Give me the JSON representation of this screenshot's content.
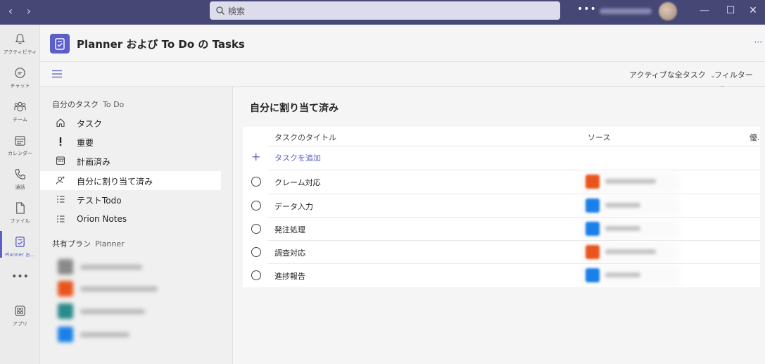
{
  "window": {
    "search_placeholder": "検索",
    "more_label": "•••"
  },
  "rail": {
    "items": [
      {
        "label": "アクティビティ",
        "icon": "bell-icon"
      },
      {
        "label": "チャット",
        "icon": "chat-icon"
      },
      {
        "label": "チーム",
        "icon": "teams-icon"
      },
      {
        "label": "カレンダー",
        "icon": "calendar-icon"
      },
      {
        "label": "通話",
        "icon": "phone-icon"
      },
      {
        "label": "ファイル",
        "icon": "file-icon"
      },
      {
        "label": "Planner お...",
        "icon": "planner-icon",
        "active": true
      },
      {
        "label": "アプリ",
        "icon": "apps-icon"
      }
    ],
    "more_label": "•••"
  },
  "header": {
    "title": "Planner および To Do の Tasks",
    "more_label": "···"
  },
  "toolbar": {
    "filter_scope": "アクティブな全タスク",
    "filter_label": "フィルター"
  },
  "leftnav": {
    "my_tasks_section": "自分のタスク",
    "my_tasks_sub": "To Do",
    "items": [
      {
        "label": "タスク",
        "icon": "home-icon"
      },
      {
        "label": "重要",
        "icon": "exclamation-icon"
      },
      {
        "label": "計画済み",
        "icon": "calendar-icon"
      },
      {
        "label": "自分に割り当て済み",
        "icon": "person-assigned-icon",
        "selected": true
      },
      {
        "label": "テストTodo",
        "icon": "list-icon"
      },
      {
        "label": "Orion Notes",
        "icon": "list-icon"
      }
    ],
    "shared_section": "共有プラン",
    "shared_sub": "Planner",
    "plans": [
      {
        "color": "#8a8a8a"
      },
      {
        "color": "#e8541c"
      },
      {
        "color": "#2a8a8a"
      },
      {
        "color": "#1a7fe8"
      }
    ]
  },
  "main": {
    "title": "自分に割り当て済み",
    "columns": {
      "title": "タスクのタイトル",
      "source": "ソース",
      "priority": "優."
    },
    "add_task_label": "タスクを追加",
    "tasks": [
      {
        "title": "クレーム対応",
        "source_color": "#e8541c"
      },
      {
        "title": "データ入力",
        "source_color": "#1a7fe8"
      },
      {
        "title": "発注処理",
        "source_color": "#1a7fe8"
      },
      {
        "title": "調査対応",
        "source_color": "#e8541c"
      },
      {
        "title": "進捗報告",
        "source_color": "#1a7fe8"
      }
    ]
  }
}
